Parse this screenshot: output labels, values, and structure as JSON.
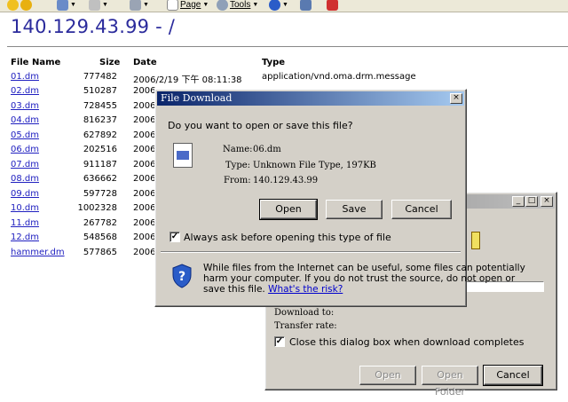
{
  "toolbar": {
    "page_label": "Page",
    "tools_label": "Tools"
  },
  "page": {
    "title": "140.129.43.99 - /",
    "headers": {
      "name": "File Name",
      "size": "Size",
      "date": "Date",
      "type": "Type"
    },
    "rows": [
      {
        "name": "01.dm",
        "size": "777482",
        "date": "2006/2/19 下午 08:11:38",
        "type": "application/vnd.oma.drm.message"
      },
      {
        "name": "02.dm",
        "size": "510287",
        "date": "2006",
        "type": ""
      },
      {
        "name": "03.dm",
        "size": "728455",
        "date": "2006",
        "type": ""
      },
      {
        "name": "04.dm",
        "size": "816237",
        "date": "2006",
        "type": ""
      },
      {
        "name": "05.dm",
        "size": "627892",
        "date": "2006",
        "type": ""
      },
      {
        "name": "06.dm",
        "size": "202516",
        "date": "2006",
        "type": ""
      },
      {
        "name": "07.dm",
        "size": "911187",
        "date": "2006",
        "type": ""
      },
      {
        "name": "08.dm",
        "size": "636662",
        "date": "2006",
        "type": ""
      },
      {
        "name": "09.dm",
        "size": "597728",
        "date": "2006",
        "type": ""
      },
      {
        "name": "10.dm",
        "size": "1002328",
        "date": "2006",
        "type": ""
      },
      {
        "name": "11.dm",
        "size": "267782",
        "date": "2006",
        "type": ""
      },
      {
        "name": "12.dm",
        "size": "548568",
        "date": "2006",
        "type": ""
      },
      {
        "name": "hammer.dm",
        "size": "577865",
        "date": "2006",
        "type": ""
      }
    ]
  },
  "file_download": {
    "title": "File Download",
    "question": "Do you want to open or save this file?",
    "name_label": "Name:",
    "name_value": "06.dm",
    "type_label": "Type:",
    "type_value": "Unknown File Type, 197KB",
    "from_label": "From:",
    "from_value": "140.129.43.99",
    "open_button": "Open",
    "save_button": "Save",
    "cancel_button": "Cancel",
    "always_ask_label": "Always ask before opening this type of file",
    "always_ask_checked": true,
    "warning_text_1": "While files from the Internet can be useful, some files can potentially",
    "warning_text_2": "harm your computer. If you do not trust the source, do not open or",
    "warning_text_3": "save this file.",
    "risk_link": "What's the risk?"
  },
  "progress_dialog": {
    "download_to_label": "Download to:",
    "transfer_rate_label": "Transfer rate:",
    "close_when_done_label": "Close this dialog box when download completes",
    "close_when_done_checked": true,
    "open_button": "Open",
    "open_folder_button": "Open Folder",
    "cancel_button": "Cancel"
  },
  "colors": {
    "link": "#2020c0",
    "title_blue": "#2b2b9c",
    "dialog_face": "#d4d0c8",
    "titlebar_active": "#0a246a"
  }
}
